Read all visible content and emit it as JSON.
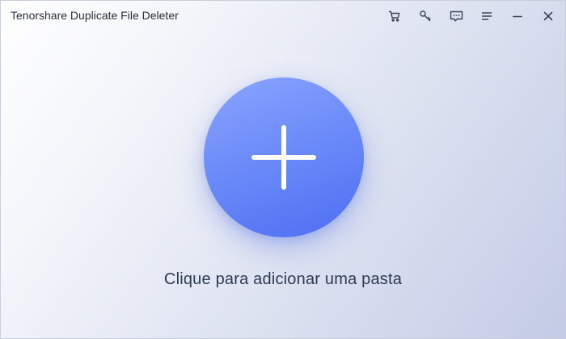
{
  "window": {
    "title": "Tenorshare Duplicate File Deleter"
  },
  "titlebar": {
    "icons": [
      "cart-icon",
      "key-icon",
      "feedback-icon",
      "menu-icon",
      "minimize-icon",
      "close-icon"
    ]
  },
  "main": {
    "add_folder_prompt": "Clique para adicionar uma pasta",
    "add_button_icon": "plus-icon"
  },
  "colors": {
    "accent": "#5b7cf6",
    "icon": "#3a4256",
    "text": "#2c3a52"
  }
}
